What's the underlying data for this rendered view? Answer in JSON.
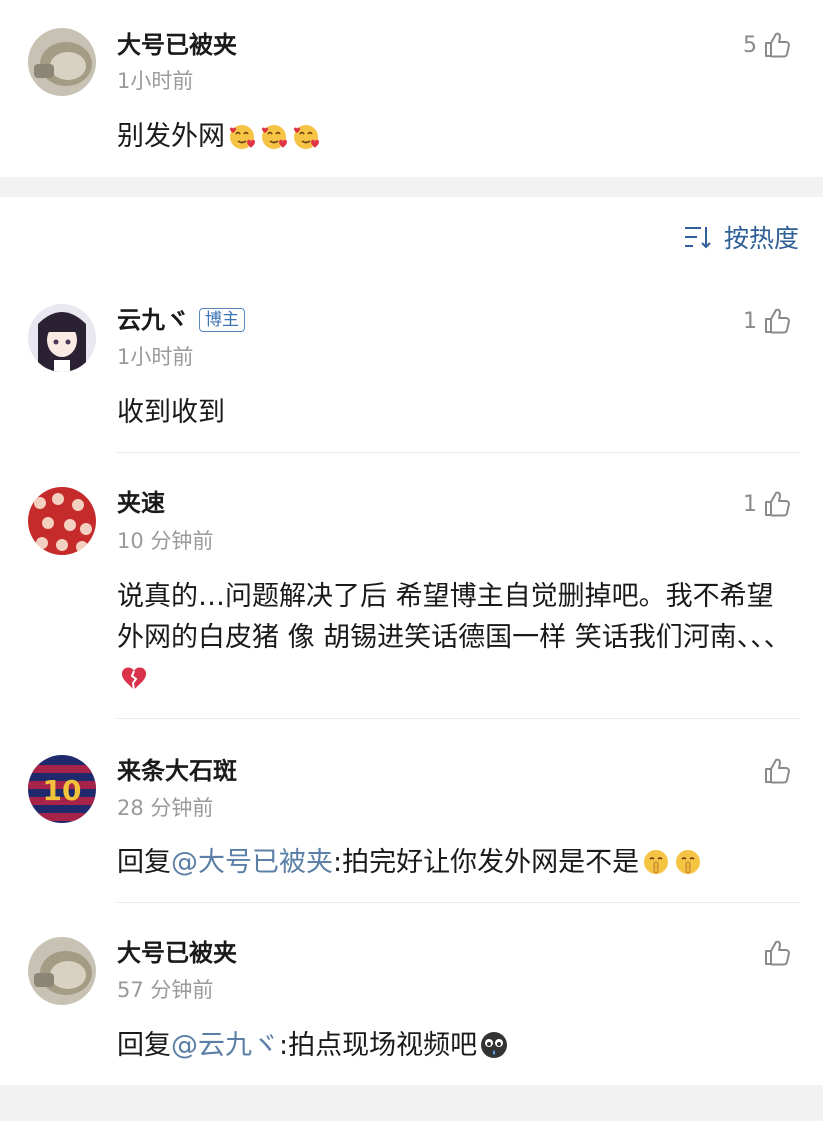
{
  "top_comment": {
    "user": "大号已被夹",
    "time": "1小时前",
    "text": "别发外网",
    "likes": "5",
    "emojis": [
      "heart-eyes-face-icon",
      "heart-eyes-face-icon",
      "heart-eyes-face-icon"
    ]
  },
  "sort_label": "按热度",
  "comments": [
    {
      "user": "云九ヾ",
      "badge": "博主",
      "time": "1小时前",
      "text": "收到收到",
      "likes": "1"
    },
    {
      "user": "夹速",
      "time": "10 分钟前",
      "text": "说真的…问题解决了后 希望博主自觉删掉吧。我不希望 外网的白皮猪 像 胡锡进笑话德国一样 笑话我们河南、、、",
      "likes": "1",
      "emojis": [
        "broken-heart-icon"
      ]
    },
    {
      "user": "来条大石斑",
      "time": "28 分钟前",
      "reply_prefix": "回复",
      "mention": "@大号已被夹",
      "text": ":拍完好让你发外网是不是",
      "likes": "",
      "emojis": [
        "shushing-face-icon",
        "shushing-face-icon"
      ]
    },
    {
      "user": "大号已被夹",
      "time": "57 分钟前",
      "reply_prefix": "回复",
      "mention": "@云九ヾ",
      "text": ":拍点现场视频吧",
      "likes": "",
      "emojis": [
        "crying-face-icon"
      ]
    }
  ],
  "colors": {
    "link": "#5b7fa6",
    "badge": "#3f74b4",
    "muted": "#9a9a9a",
    "background": "#f2f2f2"
  }
}
